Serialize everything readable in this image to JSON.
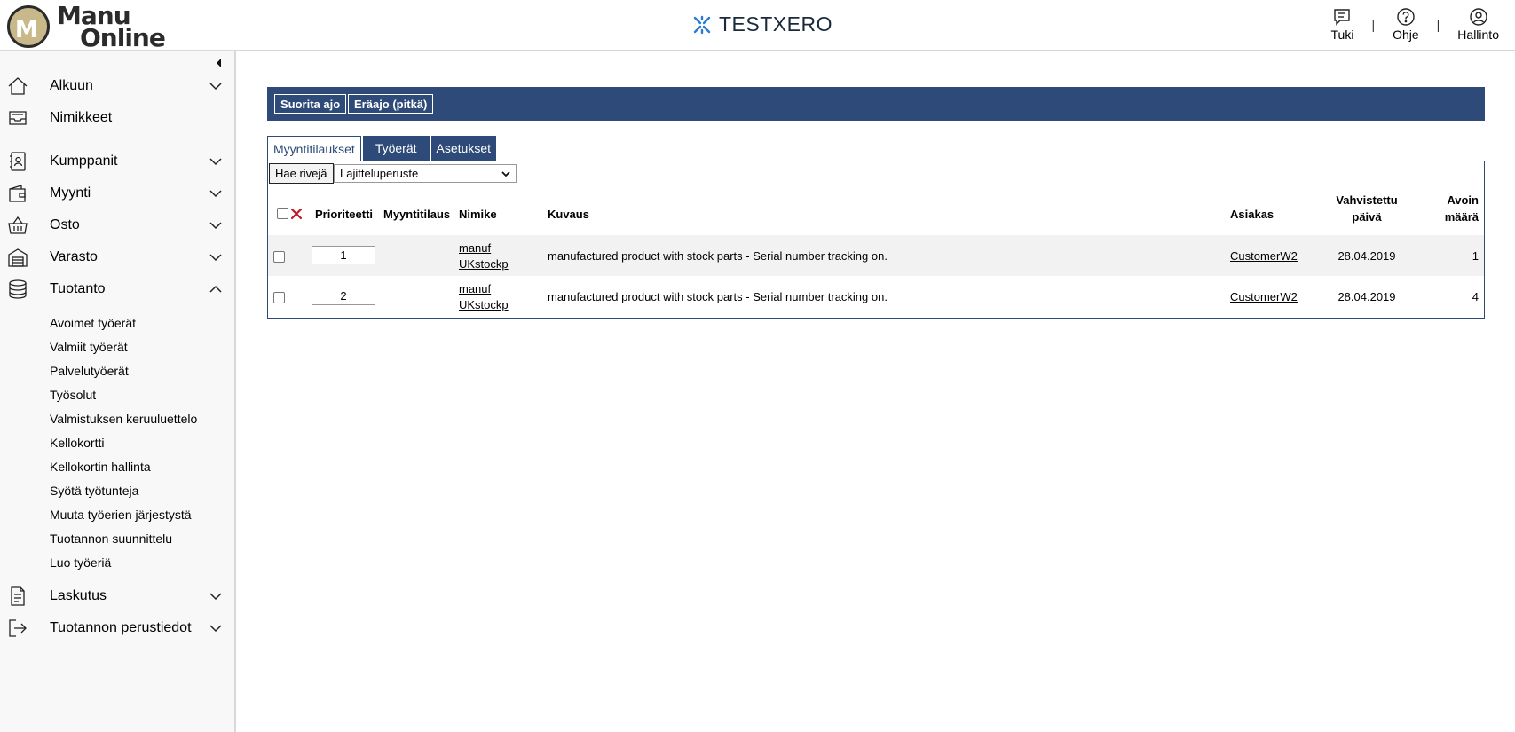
{
  "header": {
    "logo_line1": "Manu",
    "logo_line2": "Online",
    "company": "TESTXERO",
    "links": [
      {
        "label": "Tuki",
        "icon": "chat-icon"
      },
      {
        "label": "Ohje",
        "icon": "help-icon"
      },
      {
        "label": "Hallinto",
        "icon": "user-icon"
      }
    ],
    "separator": "|"
  },
  "sidebar": {
    "items": [
      {
        "label": "Alkuun",
        "icon": "home-icon",
        "chevron": "down"
      },
      {
        "label": "Nimikkeet",
        "icon": "inbox-icon",
        "chevron": ""
      },
      {
        "label": "Kumppanit",
        "icon": "contacts-icon",
        "chevron": "down"
      },
      {
        "label": "Myynti",
        "icon": "wallet-icon",
        "chevron": "down"
      },
      {
        "label": "Osto",
        "icon": "basket-icon",
        "chevron": "down"
      },
      {
        "label": "Varasto",
        "icon": "warehouse-icon",
        "chevron": "down"
      },
      {
        "label": "Tuotanto",
        "icon": "database-icon",
        "chevron": "up"
      },
      {
        "label": "Laskutus",
        "icon": "document-icon",
        "chevron": "down"
      },
      {
        "label": "Tuotannon perustiedot",
        "icon": "logout-icon",
        "chevron": "down"
      }
    ],
    "tuotanto_sub": [
      "Avoimet työerät",
      "Valmiit työerät",
      "Palvelutyöerät",
      "Työsolut",
      "Valmistuksen keruuluettelo",
      "Kellokortti",
      "Kellokortin hallinta",
      "Syötä työtunteja",
      "Muuta työerien järjestystä",
      "Tuotannon suunnittelu",
      "Luo työeriä"
    ]
  },
  "toolbar": {
    "run_label": "Suorita ajo",
    "batch_label": "Eräajo (pitkä)"
  },
  "tabs": [
    {
      "label": "Myyntitilaukset",
      "active": true
    },
    {
      "label": "Työerät",
      "active": false
    },
    {
      "label": "Asetukset",
      "active": false
    }
  ],
  "controls": {
    "fetch_label": "Hae rivejä",
    "sort_value": "Lajitteluperuste"
  },
  "table": {
    "columns": {
      "priority": "Prioriteetti",
      "sales_order": "Myyntitilaus",
      "item": "Nimike",
      "description": "Kuvaus",
      "customer": "Asiakas",
      "confirmed_1": "Vahvistettu",
      "confirmed_2": "päivä",
      "open_1": "Avoin",
      "open_2": "määrä"
    },
    "rows": [
      {
        "priority": "1",
        "sales_order": "",
        "item_1": "manuf",
        "item_2": "UKstockp",
        "description": "manufactured product with stock parts - Serial number tracking on.",
        "customer": "CustomerW2",
        "confirmed": "28.04.2019",
        "open": "1"
      },
      {
        "priority": "2",
        "sales_order": "",
        "item_1": "manuf",
        "item_2": "UKstockp",
        "description": "manufactured product with stock parts - Serial number tracking on.",
        "customer": "CustomerW2",
        "confirmed": "28.04.2019",
        "open": "4"
      }
    ]
  },
  "colors": {
    "primary": "#2d4a78",
    "delete_red": "#c0192a",
    "xero_blue": "#2a7ccf"
  }
}
